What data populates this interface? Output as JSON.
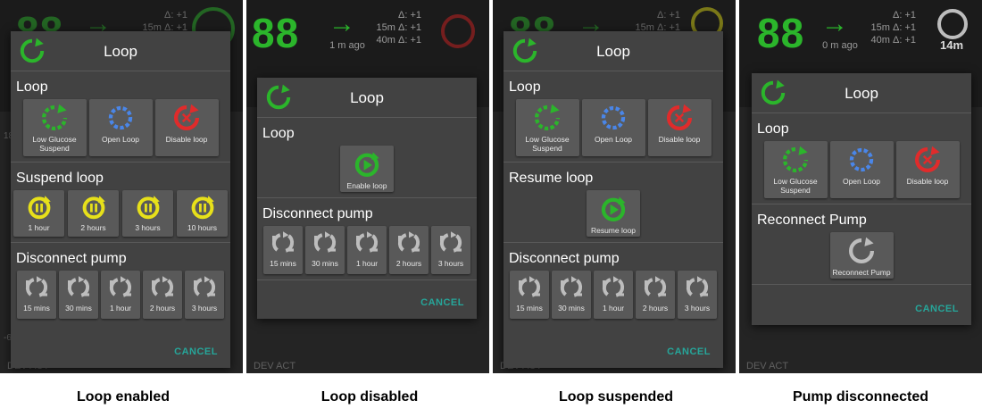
{
  "panels": [
    {
      "caption": "Loop enabled",
      "bg": {
        "glucose": "88",
        "delta1": "Δ: +1",
        "delta2": "15m Δ: +1",
        "delta3": "",
        "ago": ""
      },
      "dialog": {
        "title": "Loop",
        "sections": [
          {
            "heading": "Loop",
            "buttons": [
              {
                "icon": "low-glucose-suspend-icon",
                "label": "Low Glucose Suspend"
              },
              {
                "icon": "open-loop-icon",
                "label": "Open Loop"
              },
              {
                "icon": "disable-loop-icon",
                "label": "Disable loop"
              }
            ]
          },
          {
            "heading": "Suspend loop",
            "buttons": [
              {
                "icon": "suspend-icon",
                "label": "1 hour"
              },
              {
                "icon": "suspend-icon",
                "label": "2 hours"
              },
              {
                "icon": "suspend-icon",
                "label": "3 hours"
              },
              {
                "icon": "suspend-icon",
                "label": "10 hours"
              }
            ]
          },
          {
            "heading": "Disconnect pump",
            "buttons": [
              {
                "icon": "disconnect-pump-icon",
                "label": "15 mins"
              },
              {
                "icon": "disconnect-pump-icon",
                "label": "30 mins"
              },
              {
                "icon": "disconnect-pump-icon",
                "label": "1 hour"
              },
              {
                "icon": "disconnect-pump-icon",
                "label": "2 hours"
              },
              {
                "icon": "disconnect-pump-icon",
                "label": "3 hours"
              }
            ]
          }
        ],
        "cancel": "CANCEL"
      }
    },
    {
      "caption": "Loop disabled",
      "bg": {
        "glucose": "88",
        "delta1": "Δ: +1",
        "delta2": "15m Δ: +1",
        "delta3": "40m Δ: +1",
        "ago": "1 m ago"
      },
      "dialog": {
        "title": "Loop",
        "sections": [
          {
            "heading": "Loop",
            "buttons": [
              {
                "icon": "enable-loop-icon",
                "label": "Enable loop"
              }
            ]
          },
          {
            "heading": "Disconnect pump",
            "buttons": [
              {
                "icon": "disconnect-pump-icon",
                "label": "15 mins"
              },
              {
                "icon": "disconnect-pump-icon",
                "label": "30 mins"
              },
              {
                "icon": "disconnect-pump-icon",
                "label": "1 hour"
              },
              {
                "icon": "disconnect-pump-icon",
                "label": "2 hours"
              },
              {
                "icon": "disconnect-pump-icon",
                "label": "3 hours"
              }
            ]
          }
        ],
        "cancel": "CANCEL"
      }
    },
    {
      "caption": "Loop suspended",
      "bg": {
        "glucose": "88",
        "delta1": "Δ: +1",
        "delta2": "15m Δ: +1",
        "delta3": "",
        "ago": ""
      },
      "dialog": {
        "title": "Loop",
        "sections": [
          {
            "heading": "Loop",
            "buttons": [
              {
                "icon": "low-glucose-suspend-icon",
                "label": "Low Glucose Suspend"
              },
              {
                "icon": "open-loop-icon",
                "label": "Open Loop"
              },
              {
                "icon": "disable-loop-icon",
                "label": "Disable loop"
              }
            ]
          },
          {
            "heading": "Resume loop",
            "buttons": [
              {
                "icon": "resume-loop-icon",
                "label": "Resume loop"
              }
            ]
          },
          {
            "heading": "Disconnect pump",
            "buttons": [
              {
                "icon": "disconnect-pump-icon",
                "label": "15 mins"
              },
              {
                "icon": "disconnect-pump-icon",
                "label": "30 mins"
              },
              {
                "icon": "disconnect-pump-icon",
                "label": "1 hour"
              },
              {
                "icon": "disconnect-pump-icon",
                "label": "2 hours"
              },
              {
                "icon": "disconnect-pump-icon",
                "label": "3 hours"
              }
            ]
          }
        ],
        "cancel": "CANCEL"
      }
    },
    {
      "caption": "Pump disconnected",
      "bg": {
        "glucose": "88",
        "delta1": "Δ: +1",
        "delta2": "15m Δ: +1",
        "delta3": "40m Δ: +1",
        "ago": "0 m ago",
        "status": "14m"
      },
      "dialog": {
        "title": "Loop",
        "sections": [
          {
            "heading": "Loop",
            "buttons": [
              {
                "icon": "low-glucose-suspend-icon",
                "label": "Low Glucose Suspend"
              },
              {
                "icon": "open-loop-icon",
                "label": "Open Loop"
              },
              {
                "icon": "disable-loop-icon",
                "label": "Disable loop"
              }
            ]
          },
          {
            "heading": "Reconnect Pump",
            "buttons": [
              {
                "icon": "reconnect-pump-icon",
                "label": "Reconnect Pump"
              }
            ]
          }
        ],
        "cancel": "CANCEL"
      }
    }
  ],
  "colors": {
    "green": "#2bb52b",
    "blue": "#4a86e8",
    "red": "#e02b2b",
    "yellow": "#e7e01a",
    "grey": "#bdbdbd",
    "teal": "#26a69a"
  }
}
